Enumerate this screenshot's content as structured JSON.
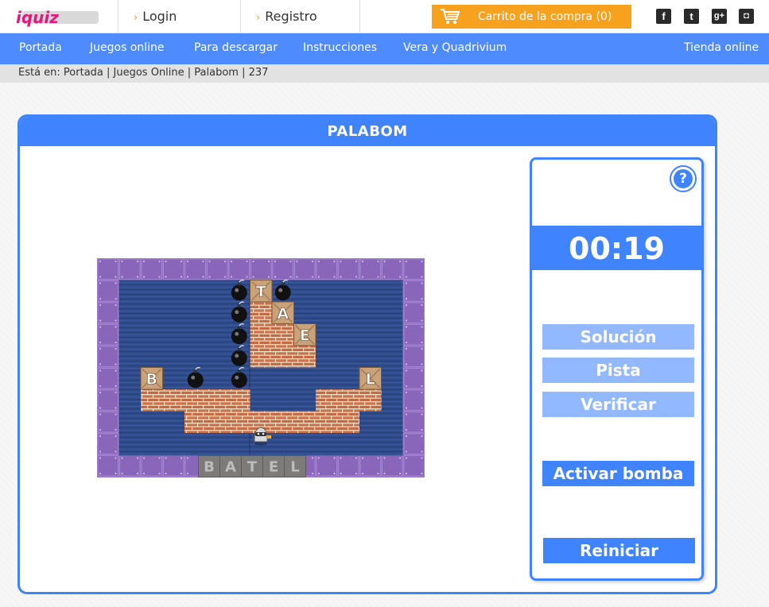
{
  "header": {
    "logo_text": "iquiz",
    "login_label": "Login",
    "register_label": "Registro",
    "cart_label": "Carrito de la compra (0)",
    "social": [
      {
        "icon": "facebook-icon",
        "glyph": "f"
      },
      {
        "icon": "twitter-icon",
        "glyph": "t"
      },
      {
        "icon": "google-plus-icon",
        "glyph": "g+"
      },
      {
        "icon": "instagram-icon",
        "glyph": "◘"
      }
    ]
  },
  "nav": {
    "items": [
      "Portada",
      "Juegos online",
      "Para descargar",
      "Instrucciones",
      "Vera y Quadrivium"
    ],
    "right_item": "Tienda online"
  },
  "breadcrumb": "Está en: Portada | Juegos Online | Palabom | 237",
  "game": {
    "title": "PALABOM",
    "timer": "00:19",
    "buttons": {
      "solution": "Solución",
      "hint": "Pista",
      "verify": "Verificar",
      "bomb": "Activar bomba",
      "restart": "Reiniciar"
    },
    "help_label": "?",
    "letter_tiles": [
      "T",
      "A",
      "E",
      "B",
      "L"
    ],
    "word_slots": [
      "B",
      "A",
      "T",
      "E",
      "L"
    ],
    "colors": {
      "accent": "#3f83ff",
      "button_light": "#92b8ff",
      "cart": "#f6a21e",
      "board_frame": "#8e6bc0",
      "board_water": "#2a4585"
    }
  }
}
